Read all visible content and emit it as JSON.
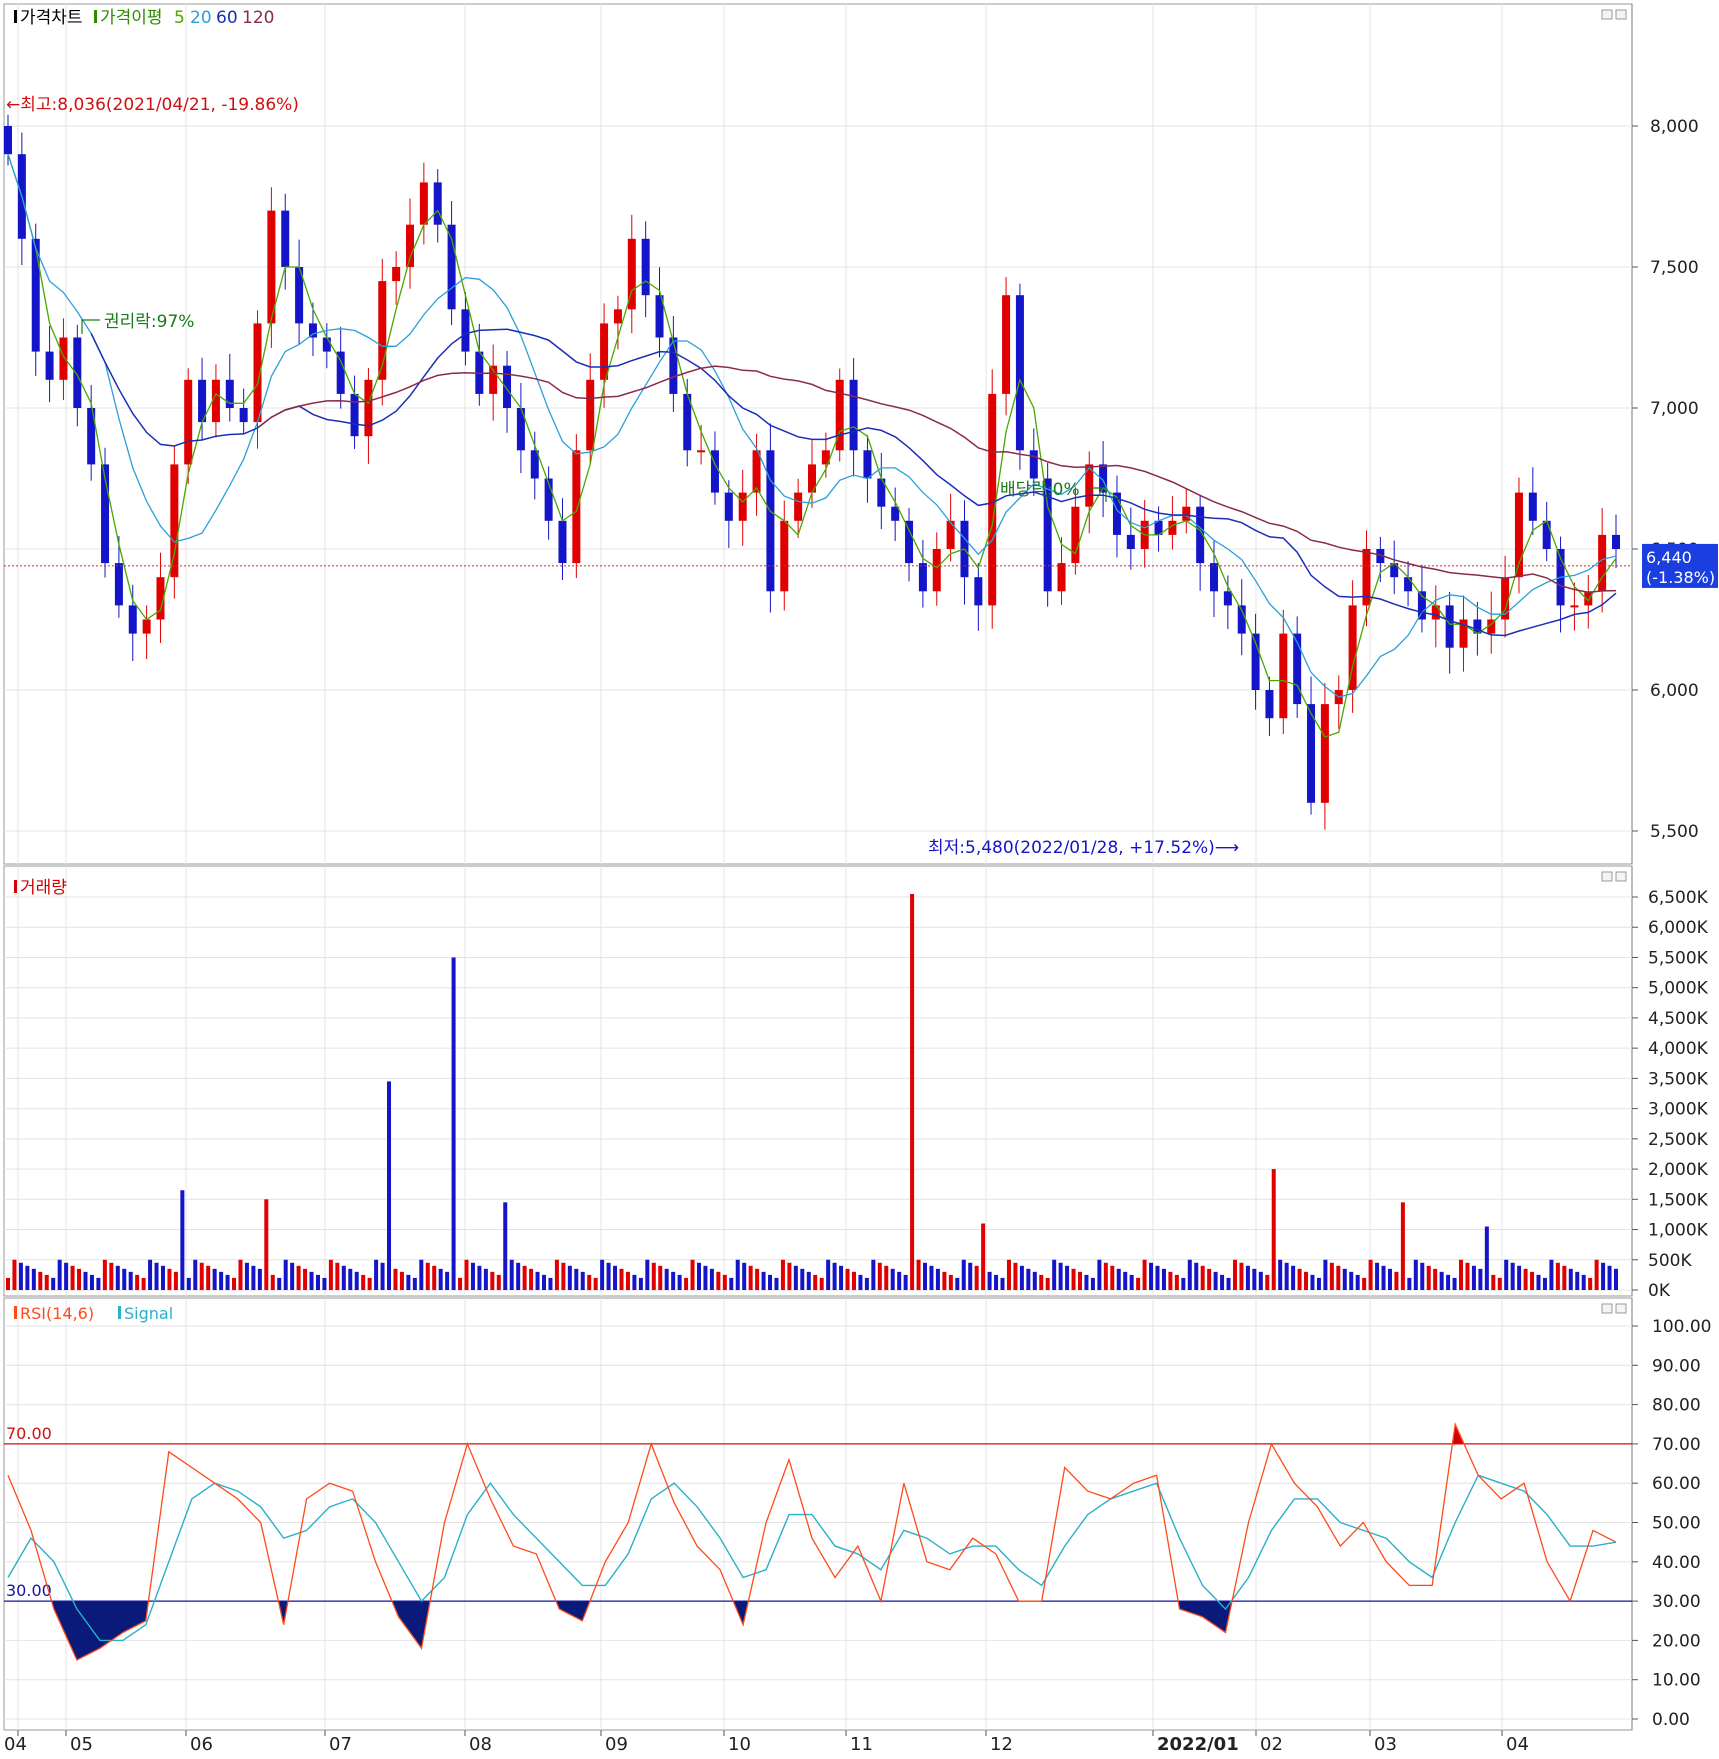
{
  "panels": {
    "price": {
      "legend": [
        {
          "text": "가격차트",
          "color": "#000000"
        },
        {
          "text": "가격이평",
          "color": "#2e8b00"
        },
        {
          "text": "5",
          "color": "#4aa800"
        },
        {
          "text": "20",
          "color": "#2aa0d8"
        },
        {
          "text": "60",
          "color": "#1b2fb5"
        },
        {
          "text": "120",
          "color": "#8a2b4a"
        }
      ],
      "high_label": "←최고:8,036(2021/04/21, -19.86%)",
      "low_label": "최저:5,480(2022/01/28, +17.52%)⟶",
      "ex_rights_label": "권리락:97%",
      "ex_dividend_label": "배당락:0%",
      "last_price": "6,440",
      "last_change": "(-1.38%)"
    },
    "volume": {
      "legend": [
        {
          "text": "거래량",
          "color": "#d40000"
        }
      ]
    },
    "rsi": {
      "legend": [
        {
          "text": "RSI(14,6)",
          "color": "#ff4a1a"
        },
        {
          "text": "Signal",
          "color": "#2ab0c8"
        }
      ],
      "upper_label": "70.00",
      "lower_label": "30.00"
    }
  },
  "colors": {
    "up": "#e00000",
    "down": "#1414c8",
    "ma5": "#4aa800",
    "ma20": "#2aa0d8",
    "ma60": "#1b2fb5",
    "ma120": "#8a2b4a",
    "rsi": "#ff4a1a",
    "signal": "#2ab0c8",
    "grid": "#e4e4e4"
  },
  "chart_data": [
    {
      "type": "candlestick",
      "title": "가격차트",
      "x_ticks": [
        "04",
        "05",
        "06",
        "07",
        "08",
        "09",
        "10",
        "11",
        "12",
        "2022/01",
        "02",
        "03",
        "04"
      ],
      "y_ticks": [
        "5,500",
        "6,000",
        "6,500",
        "7,000",
        "7,500",
        "8,000"
      ],
      "ylim": [
        5430,
        8380
      ],
      "close_series": [
        7900,
        7600,
        7200,
        7100,
        7250,
        7000,
        6800,
        6450,
        6300,
        6200,
        6250,
        6400,
        6800,
        7100,
        6950,
        7100,
        7000,
        6950,
        7300,
        7700,
        7500,
        7300,
        7250,
        7200,
        7050,
        6900,
        7100,
        7450,
        7500,
        7650,
        7800,
        7650,
        7350,
        7200,
        7050,
        7150,
        7000,
        6850,
        6750,
        6600,
        6450,
        6850,
        7100,
        7300,
        7350,
        7600,
        7400,
        7250,
        7050,
        6850,
        6850,
        6700,
        6600,
        6700,
        6850,
        6350,
        6600,
        6700,
        6800,
        6850,
        7100,
        6850,
        6750,
        6650,
        6600,
        6450,
        6350,
        6500,
        6600,
        6400,
        6300,
        7050,
        7400,
        6850,
        6750,
        6350,
        6450,
        6650,
        6800,
        6700,
        6550,
        6500,
        6600,
        6550,
        6600,
        6650,
        6450,
        6350,
        6300,
        6200,
        6000,
        5900,
        6200,
        5950,
        5600,
        5950,
        6000,
        6300,
        6500,
        6450,
        6400,
        6350,
        6250,
        6300,
        6150,
        6250,
        6200,
        6250,
        6400,
        6700,
        6600,
        6500,
        6300,
        6300,
        6350,
        6550,
        6500
      ],
      "ma_legend": [
        "5",
        "20",
        "60",
        "120"
      ],
      "high": {
        "value": 8036,
        "date": "2021/04/21",
        "change": "-19.86%"
      },
      "low": {
        "value": 5480,
        "date": "2022/01/28",
        "change": "+17.52%"
      },
      "last": {
        "value": 6440,
        "change": "-1.38%"
      }
    },
    {
      "type": "bar",
      "title": "거래량",
      "x_ticks": [
        "04",
        "05",
        "06",
        "07",
        "08",
        "09",
        "10",
        "11",
        "12",
        "2022/01",
        "02",
        "03",
        "04"
      ],
      "y_ticks": [
        "0K",
        "500K",
        "1,000K",
        "1,500K",
        "2,000K",
        "2,500K",
        "3,000K",
        "3,500K",
        "4,000K",
        "4,500K",
        "5,000K",
        "5,500K",
        "6,000K",
        "6,500K"
      ],
      "ylim": [
        0,
        6750
      ],
      "spikes_k": [
        1650,
        1500,
        3450,
        5500,
        1450,
        6550,
        1100,
        2000,
        1450,
        1050
      ],
      "baseline_k": [
        200,
        500
      ]
    },
    {
      "type": "line",
      "title": "RSI(14,6)",
      "series": [
        {
          "name": "RSI(14,6)",
          "values": [
            62,
            48,
            28,
            15,
            18,
            22,
            25,
            68,
            64,
            60,
            56,
            50,
            24,
            56,
            60,
            58,
            40,
            26,
            18,
            50,
            70,
            56,
            44,
            42,
            28,
            25,
            40,
            50,
            70,
            55,
            44,
            38,
            24,
            50,
            66,
            46,
            36,
            44,
            30,
            60,
            40,
            38,
            46,
            42,
            30,
            30,
            64,
            58,
            56,
            60,
            62,
            28,
            26,
            22,
            50,
            70,
            60,
            54,
            44,
            50,
            40,
            34,
            34,
            75,
            62,
            56,
            60,
            40,
            30,
            48,
            45
          ]
        },
        {
          "name": "Signal",
          "values": [
            36,
            46,
            40,
            28,
            20,
            20,
            24,
            40,
            56,
            60,
            58,
            54,
            46,
            48,
            54,
            56,
            50,
            40,
            30,
            36,
            52,
            60,
            52,
            46,
            40,
            34,
            34,
            42,
            56,
            60,
            54,
            46,
            36,
            38,
            52,
            52,
            44,
            42,
            38,
            48,
            46,
            42,
            44,
            44,
            38,
            34,
            44,
            52,
            56,
            58,
            60,
            46,
            34,
            28,
            36,
            48,
            56,
            56,
            50,
            48,
            46,
            40,
            36,
            50,
            62,
            60,
            58,
            52,
            44,
            44,
            45
          ]
        }
      ],
      "y_ticks": [
        "0.00",
        "10.00",
        "20.00",
        "30.00",
        "40.00",
        "50.00",
        "60.00",
        "70.00",
        "80.00",
        "90.00",
        "100.00"
      ],
      "ylim": [
        0,
        100
      ],
      "overbought": 70,
      "oversold": 30
    }
  ]
}
